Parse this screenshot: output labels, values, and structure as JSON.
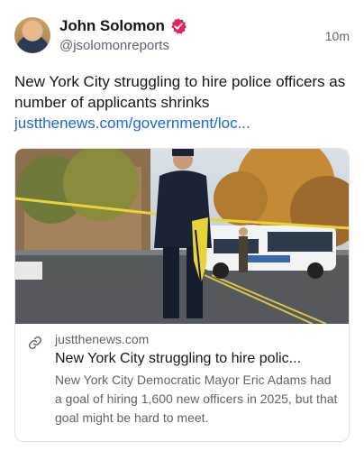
{
  "author": {
    "display_name": "John Solomon",
    "handle": "@jsolomonreports",
    "verified": true,
    "avatar_icon": "avatar-photo"
  },
  "post": {
    "timestamp": "10m",
    "text": "New York City struggling to hire police officers as number of applicants shrinks",
    "link_text": "justthenews.com/government/loc...",
    "link_color": "#1f66d6"
  },
  "link_card": {
    "image_description_icon": "news-photo-police-officer-crime-scene-tape",
    "link_icon": "link-icon",
    "domain": "justthenews.com",
    "title": "New York City struggling to hire polic...",
    "description": "New York City Democratic Mayor Eric Adams had a goal of hiring 1,600 new officers in 2025, but that goal might be hard to meet."
  },
  "colors": {
    "verified_badge": "#e0245e",
    "secondary_text": "#5b6470",
    "card_border": "#dfe3e8"
  }
}
